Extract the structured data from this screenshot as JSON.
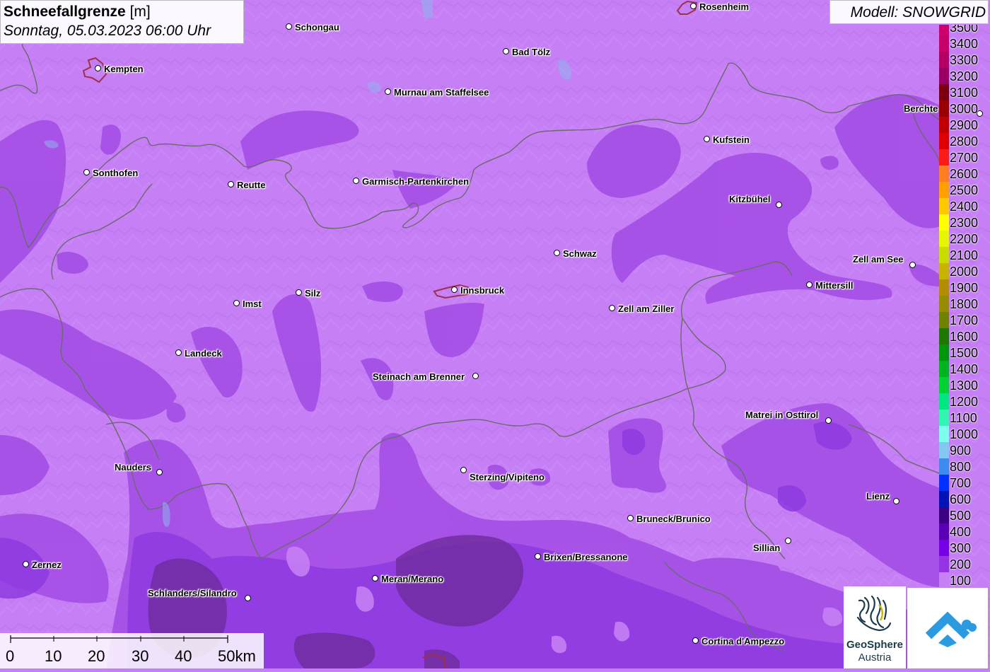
{
  "title": {
    "parameter": "Schneefallgrenze",
    "unit": "[m]",
    "datetime": "Sonntag, 05.03.2023 06:00 Uhr"
  },
  "model_label": "Modell: SNOWGRID",
  "cities": [
    {
      "name": "Rosenheim"
    },
    {
      "name": "Schongau"
    },
    {
      "name": "Bad Tölz"
    },
    {
      "name": "Kempten"
    },
    {
      "name": "Murnau am Staffelsee"
    },
    {
      "name": "Berchtesgaden",
      "visible_text": "Berchte"
    },
    {
      "name": "Kufstein"
    },
    {
      "name": "Sonthofen"
    },
    {
      "name": "Reutte"
    },
    {
      "name": "Garmisch-Partenkirchen"
    },
    {
      "name": "Kitzbühel"
    },
    {
      "name": "Schwaz"
    },
    {
      "name": "Zell am See"
    },
    {
      "name": "Mittersill"
    },
    {
      "name": "Silz"
    },
    {
      "name": "Innsbruck"
    },
    {
      "name": "Imst"
    },
    {
      "name": "Zell am Ziller"
    },
    {
      "name": "Landeck"
    },
    {
      "name": "Steinach am Brenner"
    },
    {
      "name": "Matrei in Osttirol"
    },
    {
      "name": "Nauders"
    },
    {
      "name": "Sterzing/Vipiteno"
    },
    {
      "name": "Lienz"
    },
    {
      "name": "Bruneck/Brunico"
    },
    {
      "name": "Sillian"
    },
    {
      "name": "Brixen/Bressanone"
    },
    {
      "name": "Zernez"
    },
    {
      "name": "Meran/Merano"
    },
    {
      "name": "Schlanders/Silandro"
    },
    {
      "name": "Cortina d'Ampezzo"
    }
  ],
  "legend": [
    {
      "label": "3500",
      "color": "#d0006f"
    },
    {
      "label": "3400",
      "color": "#c8006a"
    },
    {
      "label": "3300",
      "color": "#b40064"
    },
    {
      "label": "3200",
      "color": "#9a0064"
    },
    {
      "label": "3100",
      "color": "#7a0010"
    },
    {
      "label": "3000",
      "color": "#9a0000"
    },
    {
      "label": "2900",
      "color": "#c20000"
    },
    {
      "label": "2800",
      "color": "#e00000"
    },
    {
      "label": "2700",
      "color": "#ff1a1a"
    },
    {
      "label": "2600",
      "color": "#ff7f1f"
    },
    {
      "label": "2500",
      "color": "#ff9f00"
    },
    {
      "label": "2400",
      "color": "#ffc800"
    },
    {
      "label": "2300",
      "color": "#ffff00"
    },
    {
      "label": "2200",
      "color": "#e6f500"
    },
    {
      "label": "2100",
      "color": "#c8dc00"
    },
    {
      "label": "2000",
      "color": "#c8b400"
    },
    {
      "label": "1900",
      "color": "#b48c00"
    },
    {
      "label": "1800",
      "color": "#968c00"
    },
    {
      "label": "1700",
      "color": "#6e8200"
    },
    {
      "label": "1600",
      "color": "#1e7800"
    },
    {
      "label": "1500",
      "color": "#00960a"
    },
    {
      "label": "1400",
      "color": "#00b41e"
    },
    {
      "label": "1300",
      "color": "#00d232"
    },
    {
      "label": "1200",
      "color": "#00e682"
    },
    {
      "label": "1100",
      "color": "#32f5b4"
    },
    {
      "label": "1000",
      "color": "#7dfff0"
    },
    {
      "label": "900",
      "color": "#82c8f0"
    },
    {
      "label": "800",
      "color": "#3c8cf0"
    },
    {
      "label": "700",
      "color": "#0032ff"
    },
    {
      "label": "600",
      "color": "#0014b4"
    },
    {
      "label": "500",
      "color": "#3c0082"
    },
    {
      "label": "400",
      "color": "#5a00b4"
    },
    {
      "label": "300",
      "color": "#7800e6"
    },
    {
      "label": "200",
      "color": "#9632e6"
    },
    {
      "label": "100",
      "color": "#c67ff5"
    }
  ],
  "scale_bar": {
    "labels": [
      "0",
      "10",
      "20",
      "30",
      "40",
      "50km"
    ]
  },
  "logos": {
    "geosphere_line1": "GeoSphere",
    "geosphere_line2": "Austria"
  },
  "colors": {
    "base": "#c67ff5",
    "band_200": "#a44ee6",
    "band_300": "#8a35d8",
    "band_400": "#6d2a9e",
    "border": "#6a6a6a"
  },
  "icons": [
    "geosphere-logo-icon",
    "cloud-house-logo-icon"
  ]
}
